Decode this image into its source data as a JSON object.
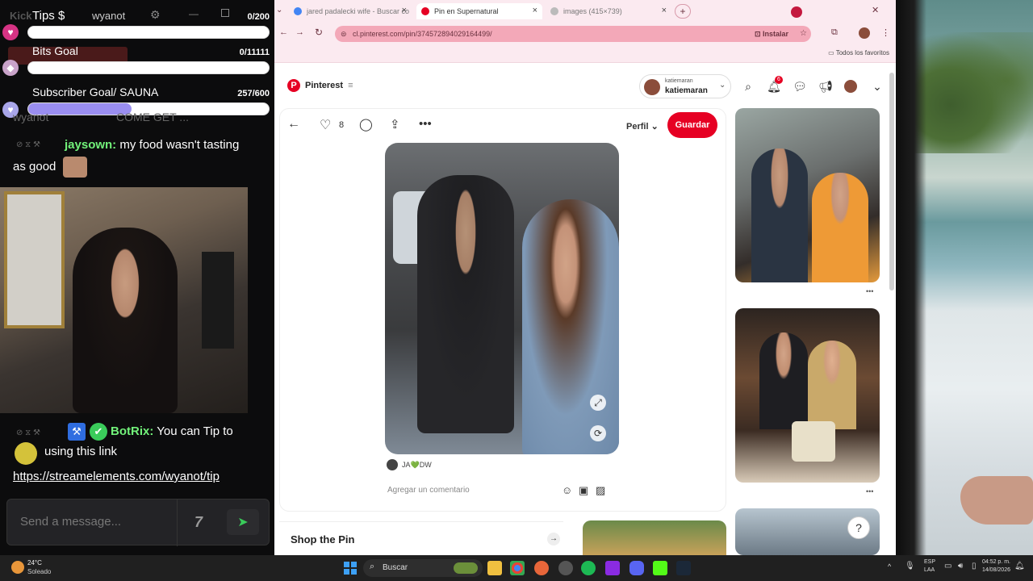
{
  "overlay": {
    "tips_title": "Tips $",
    "tips_count": "0/200",
    "bits_title": "Bits Goal",
    "bits_count": "0/11111",
    "sub_title": "Subscriber Goal/ SAUNA",
    "sub_count": "257/600",
    "sub_progress": 0.43,
    "bg_channel": "Kick",
    "bg_user": "wyanot",
    "behind_user": "wyanot",
    "behind_text": "COME GET ..."
  },
  "chat": {
    "msg1_user": "jaysown:",
    "msg1_text": "my food wasn't tasting as good",
    "msg2_user": "BotRix:",
    "msg2_text": "You can Tip to",
    "msg2_text2": "using this link",
    "msg2_link": "https://streamelements.com/wyanot/tip",
    "input_placeholder": "Send a message..."
  },
  "browser": {
    "tabs": [
      {
        "label": "jared padalecki wife - Buscar co"
      },
      {
        "label": "Pin en Supernatural"
      },
      {
        "label": "images (415×739)"
      }
    ],
    "url": "cl.pinterest.com/pin/374572894029164499/",
    "install_label": "Instalar",
    "favorites_label": "Todos los favoritos"
  },
  "pinterest": {
    "brand": "Pinterest",
    "account_small": "katiemaran",
    "account_name": "katiemaran",
    "notif_count": "6",
    "like_count": "8",
    "profile_label": "Perfil",
    "save_label": "Guardar",
    "credit": "JA💚DW",
    "comment_placeholder": "Agregar un comentario",
    "shop_label": "Shop the Pin"
  },
  "taskbar": {
    "weather_temp": "24°C",
    "weather_desc": "Soleado",
    "search_label": "Buscar",
    "lang_top": "ESP",
    "lang_bottom": "LAA",
    "time": "04:52 p. m.",
    "date": "14/08/2026"
  }
}
